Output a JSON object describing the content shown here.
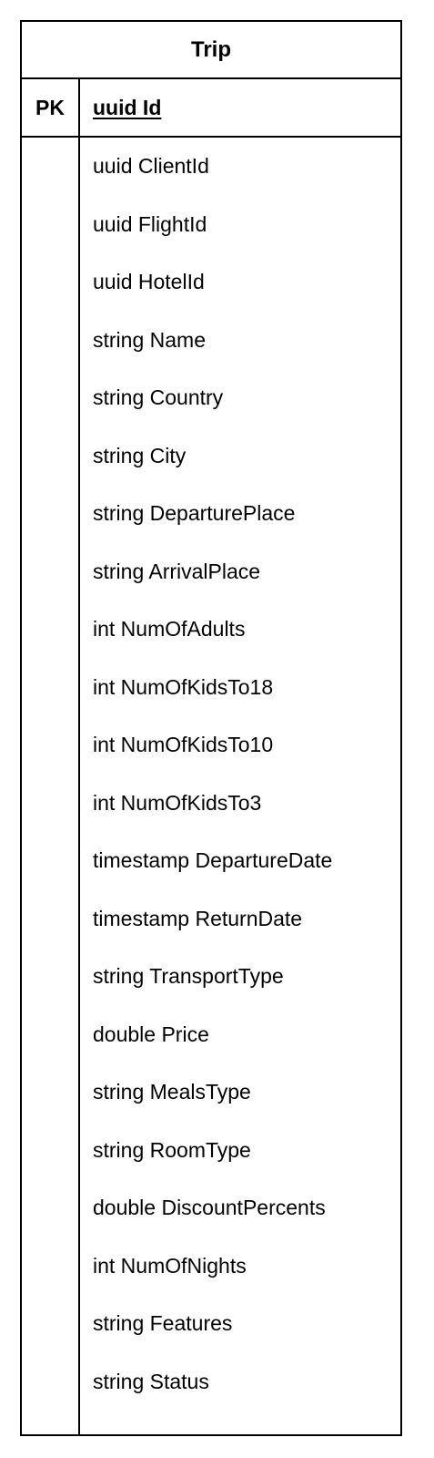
{
  "entity": {
    "name": "Trip",
    "primary_key": {
      "label": "PK",
      "field": "uuid Id"
    },
    "fields": [
      "uuid ClientId",
      "uuid FlightId",
      "uuid HotelId",
      "string Name",
      "string Country",
      "string City",
      "string DeparturePlace",
      "string ArrivalPlace",
      "int NumOfAdults",
      "int NumOfKidsTo18",
      "int NumOfKidsTo10",
      "int NumOfKidsTo3",
      "timestamp DepartureDate",
      "timestamp ReturnDate",
      "string TransportType",
      "double Price",
      "string MealsType",
      "string RoomType",
      "double DiscountPercents",
      "int NumOfNights",
      "string Features",
      "string Status"
    ]
  }
}
